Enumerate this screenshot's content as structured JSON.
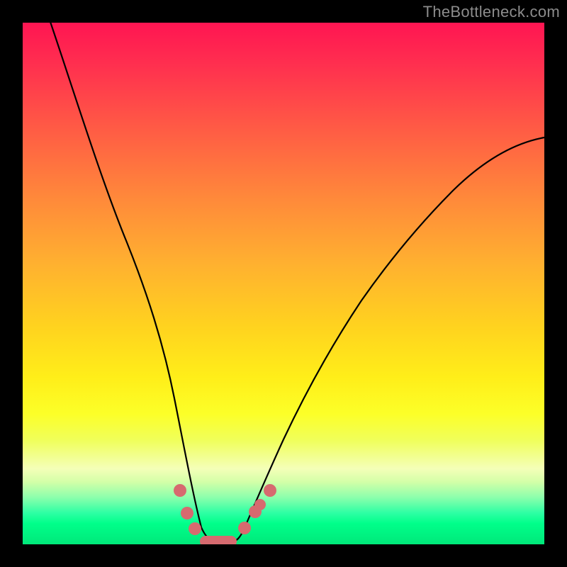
{
  "watermark": {
    "text": "TheBottleneck.com"
  },
  "chart_data": {
    "type": "line",
    "title": "",
    "xlabel": "",
    "ylabel": "",
    "xlim": [
      0,
      1
    ],
    "ylim": [
      0,
      1
    ],
    "background": "rainbow-gradient (red top → green bottom, implies high→low bottleneck)",
    "series": [
      {
        "name": "bottleneck-curve",
        "x": [
          0.0,
          0.05,
          0.1,
          0.15,
          0.2,
          0.25,
          0.28,
          0.3,
          0.32,
          0.34,
          0.36,
          0.38,
          0.4,
          0.42,
          0.45,
          0.5,
          0.55,
          0.6,
          0.65,
          0.7,
          0.75,
          0.8,
          0.85,
          0.9,
          0.95,
          1.0
        ],
        "y": [
          1.0,
          0.9,
          0.78,
          0.64,
          0.48,
          0.3,
          0.18,
          0.1,
          0.05,
          0.02,
          0.005,
          0.005,
          0.005,
          0.02,
          0.06,
          0.15,
          0.25,
          0.34,
          0.42,
          0.49,
          0.56,
          0.62,
          0.67,
          0.72,
          0.75,
          0.78
        ]
      }
    ],
    "markers": {
      "name": "highlighted-points",
      "color": "#d66a6f",
      "points": [
        {
          "x": 0.3,
          "y": 0.1
        },
        {
          "x": 0.315,
          "y": 0.055
        },
        {
          "x": 0.33,
          "y": 0.03
        },
        {
          "x": 0.36,
          "y": 0.005
        },
        {
          "x": 0.395,
          "y": 0.005
        },
        {
          "x": 0.425,
          "y": 0.02
        },
        {
          "x": 0.445,
          "y": 0.045
        },
        {
          "x": 0.455,
          "y": 0.06
        },
        {
          "x": 0.475,
          "y": 0.095
        }
      ],
      "flat_segment": {
        "x0": 0.34,
        "x1": 0.41,
        "y": 0.005
      }
    }
  }
}
